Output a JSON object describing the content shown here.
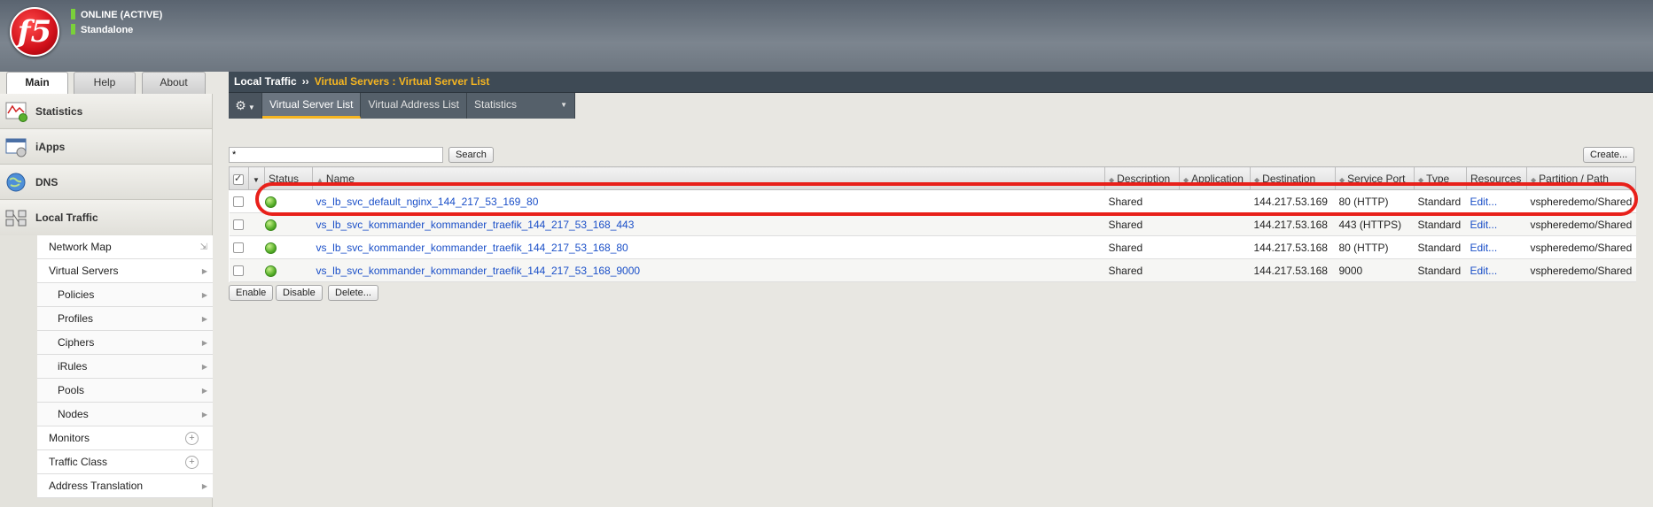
{
  "header": {
    "logo_text": "f5",
    "status": "ONLINE (ACTIVE)",
    "mode": "Standalone"
  },
  "sidebar": {
    "tabs": [
      {
        "label": "Main",
        "active": true
      },
      {
        "label": "Help"
      },
      {
        "label": "About"
      }
    ],
    "sections": [
      {
        "label": "Statistics",
        "icon": "statistics-icon"
      },
      {
        "label": "iApps",
        "icon": "iapps-icon"
      },
      {
        "label": "DNS",
        "icon": "dns-globe-icon"
      },
      {
        "label": "Local Traffic",
        "icon": "local-traffic-icon"
      }
    ],
    "local_traffic_items": [
      {
        "label": "Network Map",
        "level": 1
      },
      {
        "label": "Virtual Servers",
        "level": 1,
        "selected": true
      },
      {
        "label": "Policies",
        "level": 2
      },
      {
        "label": "Profiles",
        "level": 2
      },
      {
        "label": "Ciphers",
        "level": 2
      },
      {
        "label": "iRules",
        "level": 2
      },
      {
        "label": "Pools",
        "level": 2
      },
      {
        "label": "Nodes",
        "level": 2
      },
      {
        "label": "Monitors",
        "level": 1
      },
      {
        "label": "Traffic Class",
        "level": 1
      },
      {
        "label": "Address Translation",
        "level": 1
      }
    ]
  },
  "breadcrumb": {
    "section": "Local Traffic",
    "separator": "››",
    "current": "Virtual Servers : Virtual Server List"
  },
  "subtabs": {
    "gear": "⚙",
    "items": [
      {
        "label": "Virtual Server List",
        "active": true
      },
      {
        "label": "Virtual Address List"
      },
      {
        "label": "Statistics",
        "dropdown": true
      }
    ]
  },
  "search": {
    "value": "*",
    "button": "Search"
  },
  "create_button": "Create...",
  "table": {
    "columns": [
      "Status",
      "Name",
      "Description",
      "Application",
      "Destination",
      "Service Port",
      "Type",
      "Resources",
      "Partition / Path"
    ],
    "rows": [
      {
        "status": "available",
        "name": "vs_lb_svc_default_nginx_144_217_53_169_80",
        "description": "Shared",
        "application": "",
        "destination": "144.217.53.169",
        "service_port": "80 (HTTP)",
        "type": "Standard",
        "resources": "Edit...",
        "partition": "vspheredemo/Shared"
      },
      {
        "status": "available",
        "name": "vs_lb_svc_kommander_kommander_traefik_144_217_53_168_443",
        "description": "Shared",
        "application": "",
        "destination": "144.217.53.168",
        "service_port": "443 (HTTPS)",
        "type": "Standard",
        "resources": "Edit...",
        "partition": "vspheredemo/Shared"
      },
      {
        "status": "available",
        "name": "vs_lb_svc_kommander_kommander_traefik_144_217_53_168_80",
        "description": "Shared",
        "application": "",
        "destination": "144.217.53.168",
        "service_port": "80 (HTTP)",
        "type": "Standard",
        "resources": "Edit...",
        "partition": "vspheredemo/Shared"
      },
      {
        "status": "available",
        "name": "vs_lb_svc_kommander_kommander_traefik_144_217_53_168_9000",
        "description": "Shared",
        "application": "",
        "destination": "144.217.53.168",
        "service_port": "9000",
        "type": "Standard",
        "resources": "Edit...",
        "partition": "vspheredemo/Shared"
      }
    ]
  },
  "actions": {
    "enable": "Enable",
    "disable": "Disable",
    "delete": "Delete..."
  },
  "colors": {
    "accent": "#f5b521",
    "highlight": "#e8201a",
    "status_green": "#58b02a",
    "link": "#1a4fc8"
  }
}
